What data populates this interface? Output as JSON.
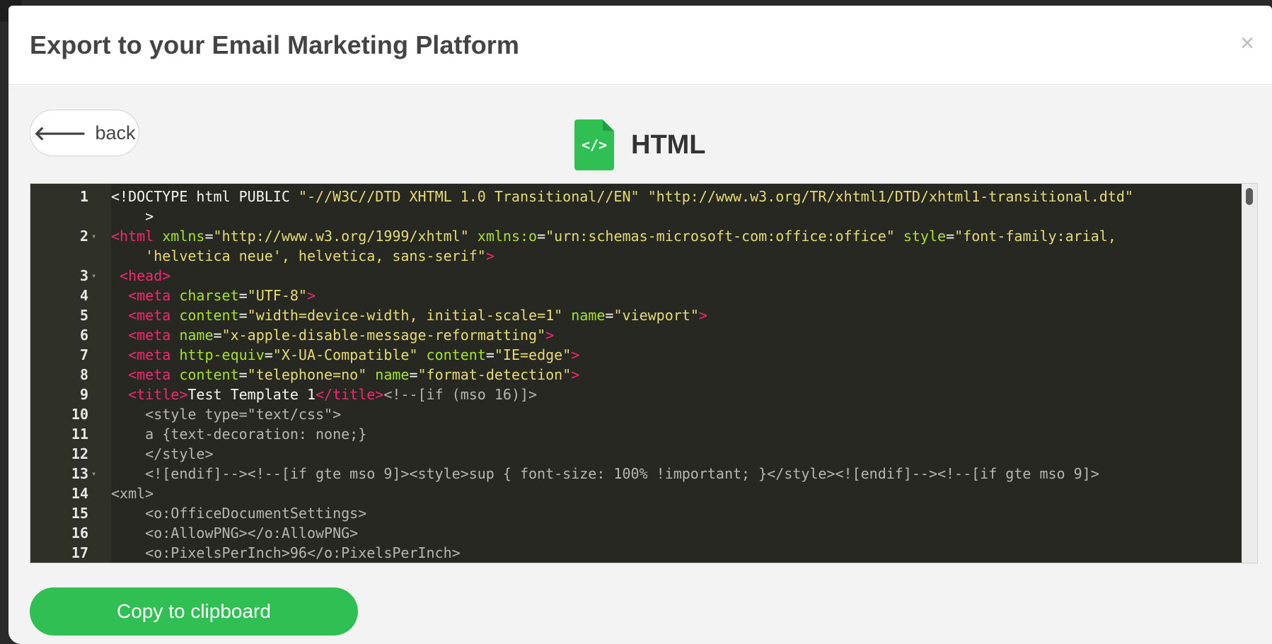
{
  "modal": {
    "title": "Export to your Email Marketing Platform",
    "close_label": "×"
  },
  "back_button": {
    "label": "back",
    "icon": "arrow-left-icon"
  },
  "format": {
    "icon": "html-file-icon",
    "icon_glyph": "</>",
    "title": "HTML"
  },
  "editor": {
    "lines": [
      {
        "num": "1",
        "fold": false,
        "segments": [
          {
            "t": "doctype",
            "v": "<!DOCTYPE html PUBLIC "
          },
          {
            "t": "str",
            "v": "\"-//W3C//DTD XHTML 1.0 Transitional//EN\""
          },
          {
            "t": "plain",
            "v": " "
          },
          {
            "t": "str",
            "v": "\"http://www.w3.org/TR/xhtml1/DTD/xhtml1-transitional.dtd\""
          }
        ]
      },
      {
        "num": "",
        "fold": false,
        "segments": [
          {
            "t": "plain",
            "v": "    >"
          }
        ]
      },
      {
        "num": "2",
        "fold": true,
        "segments": [
          {
            "t": "tag",
            "v": "<html"
          },
          {
            "t": "attr",
            "v": " xmlns"
          },
          {
            "t": "plain",
            "v": "="
          },
          {
            "t": "str",
            "v": "\"http://www.w3.org/1999/xhtml\""
          },
          {
            "t": "attr",
            "v": " xmlns:o"
          },
          {
            "t": "plain",
            "v": "="
          },
          {
            "t": "str",
            "v": "\"urn:schemas-microsoft-com:office:office\""
          },
          {
            "t": "attr",
            "v": " style"
          },
          {
            "t": "plain",
            "v": "="
          },
          {
            "t": "str",
            "v": "\"font-family:arial,"
          }
        ]
      },
      {
        "num": "",
        "fold": false,
        "segments": [
          {
            "t": "str",
            "v": "    'helvetica neue', helvetica, sans-serif\""
          },
          {
            "t": "tag",
            "v": ">"
          }
        ]
      },
      {
        "num": "3",
        "fold": true,
        "segments": [
          {
            "t": "tag",
            "v": " <head>"
          }
        ]
      },
      {
        "num": "4",
        "fold": false,
        "segments": [
          {
            "t": "tag",
            "v": "  <meta"
          },
          {
            "t": "attr",
            "v": " charset"
          },
          {
            "t": "plain",
            "v": "="
          },
          {
            "t": "str",
            "v": "\"UTF-8\""
          },
          {
            "t": "tag",
            "v": ">"
          }
        ]
      },
      {
        "num": "5",
        "fold": false,
        "segments": [
          {
            "t": "tag",
            "v": "  <meta"
          },
          {
            "t": "attr",
            "v": " content"
          },
          {
            "t": "plain",
            "v": "="
          },
          {
            "t": "str",
            "v": "\"width=device-width, initial-scale=1\""
          },
          {
            "t": "attr",
            "v": " name"
          },
          {
            "t": "plain",
            "v": "="
          },
          {
            "t": "str",
            "v": "\"viewport\""
          },
          {
            "t": "tag",
            "v": ">"
          }
        ]
      },
      {
        "num": "6",
        "fold": false,
        "segments": [
          {
            "t": "tag",
            "v": "  <meta"
          },
          {
            "t": "attr",
            "v": " name"
          },
          {
            "t": "plain",
            "v": "="
          },
          {
            "t": "str",
            "v": "\"x-apple-disable-message-reformatting\""
          },
          {
            "t": "tag",
            "v": ">"
          }
        ]
      },
      {
        "num": "7",
        "fold": false,
        "segments": [
          {
            "t": "tag",
            "v": "  <meta"
          },
          {
            "t": "attr",
            "v": " http-equiv"
          },
          {
            "t": "plain",
            "v": "="
          },
          {
            "t": "str",
            "v": "\"X-UA-Compatible\""
          },
          {
            "t": "attr",
            "v": " content"
          },
          {
            "t": "plain",
            "v": "="
          },
          {
            "t": "str",
            "v": "\"IE=edge\""
          },
          {
            "t": "tag",
            "v": ">"
          }
        ]
      },
      {
        "num": "8",
        "fold": false,
        "segments": [
          {
            "t": "tag",
            "v": "  <meta"
          },
          {
            "t": "attr",
            "v": " content"
          },
          {
            "t": "plain",
            "v": "="
          },
          {
            "t": "str",
            "v": "\"telephone=no\""
          },
          {
            "t": "attr",
            "v": " name"
          },
          {
            "t": "plain",
            "v": "="
          },
          {
            "t": "str",
            "v": "\"format-detection\""
          },
          {
            "t": "tag",
            "v": ">"
          }
        ]
      },
      {
        "num": "9",
        "fold": false,
        "segments": [
          {
            "t": "tag",
            "v": "  <title>"
          },
          {
            "t": "plain",
            "v": "Test Template 1"
          },
          {
            "t": "tag",
            "v": "</title>"
          },
          {
            "t": "comment",
            "v": "<!--[if (mso 16)]>"
          }
        ]
      },
      {
        "num": "10",
        "fold": false,
        "segments": [
          {
            "t": "comment",
            "v": "    <style type=\"text/css\">"
          }
        ]
      },
      {
        "num": "11",
        "fold": false,
        "segments": [
          {
            "t": "comment",
            "v": "    a {text-decoration: none;}"
          }
        ]
      },
      {
        "num": "12",
        "fold": false,
        "segments": [
          {
            "t": "comment",
            "v": "    </style>"
          }
        ]
      },
      {
        "num": "13",
        "fold": true,
        "segments": [
          {
            "t": "comment",
            "v": "    <![endif]--><!--[if gte mso 9]><style>sup { font-size: 100% !important; }</style><![endif]--><!--[if gte mso 9]>"
          }
        ]
      },
      {
        "num": "14",
        "fold": false,
        "segments": [
          {
            "t": "comment",
            "v": "<xml>"
          }
        ]
      },
      {
        "num": "15",
        "fold": false,
        "segments": [
          {
            "t": "comment",
            "v": "    <o:OfficeDocumentSettings>"
          }
        ]
      },
      {
        "num": "16",
        "fold": false,
        "segments": [
          {
            "t": "comment",
            "v": "    <o:AllowPNG></o:AllowPNG>"
          }
        ]
      },
      {
        "num": "17",
        "fold": false,
        "segments": [
          {
            "t": "comment",
            "v": "    <o:PixelsPerInch>96</o:PixelsPerInch>"
          }
        ]
      }
    ]
  },
  "copy_button": {
    "label": "Copy to clipboard"
  },
  "colors": {
    "accent": "#2fbf52",
    "editor_bg": "#272822",
    "tag": "#f92672",
    "attr": "#a6e22e",
    "string": "#e6db74"
  }
}
